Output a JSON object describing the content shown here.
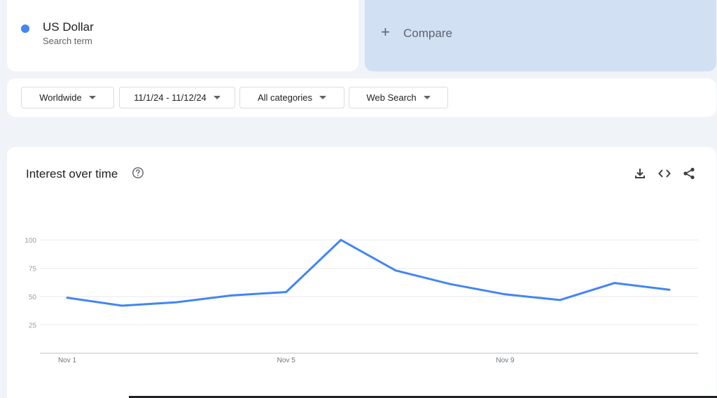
{
  "search_term": {
    "name": "US Dollar",
    "subtitle": "Search term",
    "color": "#4285f4"
  },
  "compare": {
    "label": "Compare"
  },
  "filters": [
    {
      "label": "Worldwide"
    },
    {
      "label": "11/1/24 - 11/12/24"
    },
    {
      "label": "All categories"
    },
    {
      "label": "Web Search"
    }
  ],
  "chart": {
    "title": "Interest over time",
    "icons": [
      "help-icon",
      "download-icon",
      "embed-icon",
      "share-icon"
    ]
  },
  "chart_data": {
    "type": "line",
    "x": [
      "Nov 1",
      "Nov 2",
      "Nov 3",
      "Nov 4",
      "Nov 5",
      "Nov 6",
      "Nov 7",
      "Nov 8",
      "Nov 9",
      "Nov 10",
      "Nov 11",
      "Nov 12"
    ],
    "x_tick_labels": [
      "Nov 1",
      "Nov 5",
      "Nov 9"
    ],
    "y_ticks": [
      25,
      50,
      75,
      100
    ],
    "ylim": [
      0,
      100
    ],
    "grid": true,
    "series": [
      {
        "values": [
          49,
          42,
          45,
          51,
          54,
          100,
          73,
          61,
          52,
          47,
          62,
          56
        ],
        "color": "#4285f4"
      }
    ]
  }
}
